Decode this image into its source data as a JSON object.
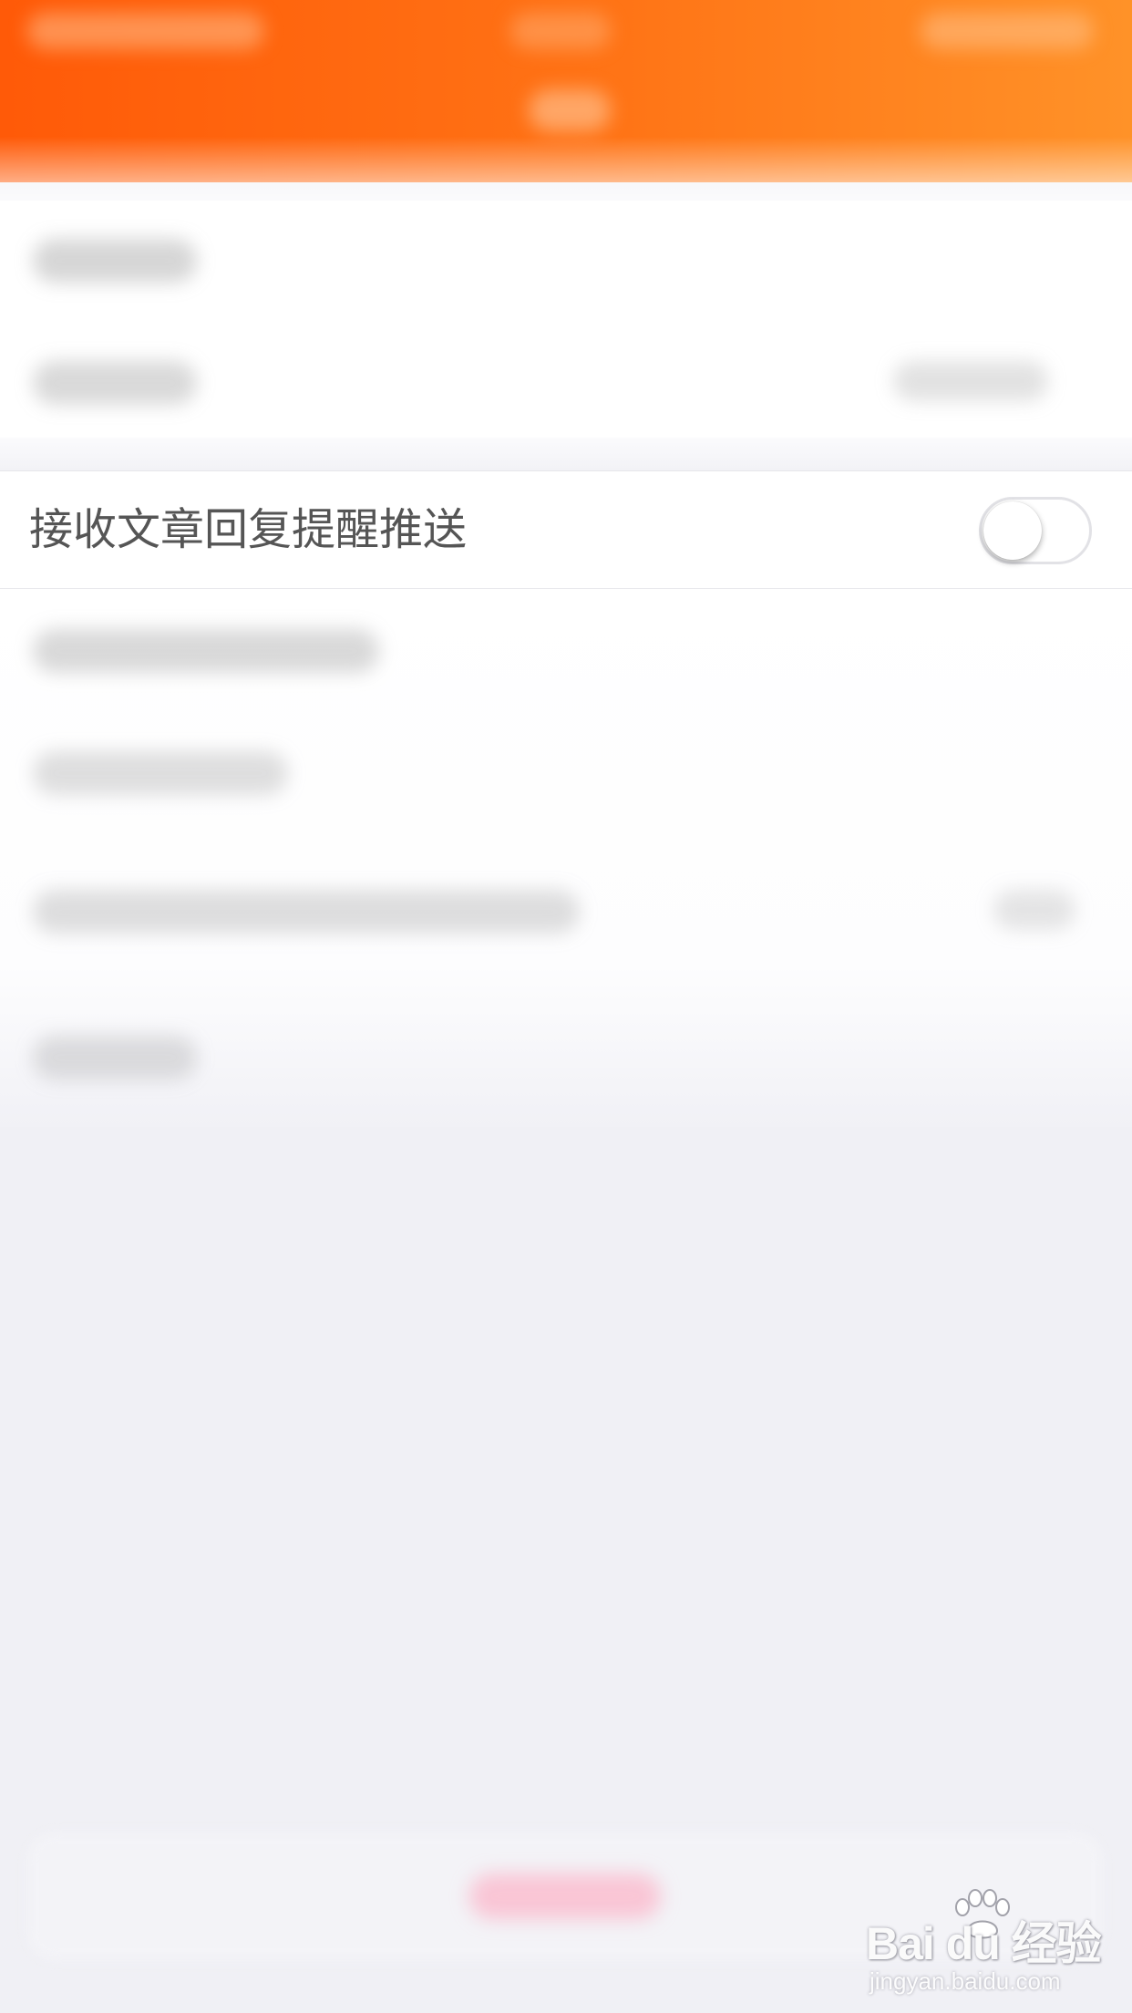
{
  "settings": {
    "reply_push_label": "接收文章回复提醒推送",
    "reply_push_enabled": false
  },
  "watermark": {
    "brand": "Bai du 经验",
    "url": "jingyan.baidu.com"
  },
  "colors": {
    "header_start": "#ff5a08",
    "header_end": "#ff9228",
    "page_background": "#f0f0f5",
    "label_text": "#555555"
  },
  "icons": {
    "watermark_mark": "paw-print-icon"
  }
}
